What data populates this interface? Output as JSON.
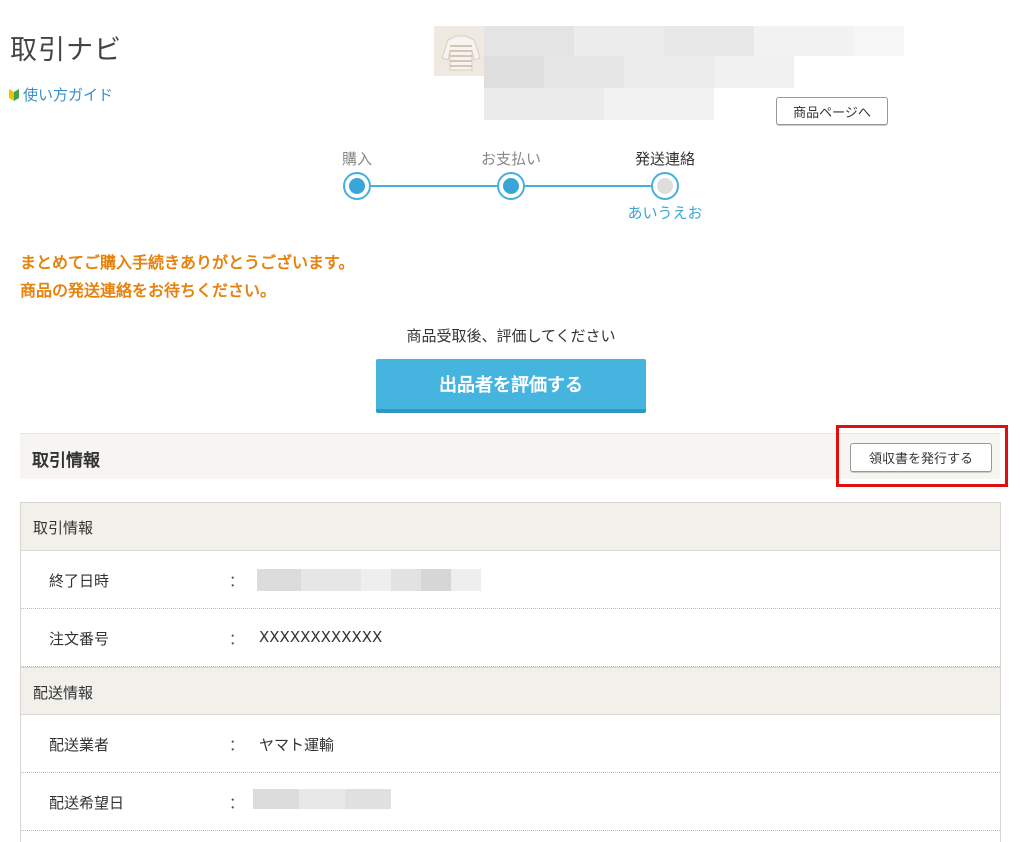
{
  "header": {
    "title": "取引ナビ",
    "guide_label": "使い方ガイド",
    "product_page_button": "商品ページへ"
  },
  "steps": [
    {
      "label": "購入",
      "state": "done"
    },
    {
      "label": "お支払い",
      "state": "done"
    },
    {
      "label": "発送連絡",
      "state": "current",
      "sub": "あいうえお"
    }
  ],
  "notice": {
    "line1": "まとめてご購入手続きありがとうございます。",
    "line2": "商品の発送連絡をお待ちください。"
  },
  "evaluation": {
    "prompt": "商品受取後、評価してください",
    "button": "出品者を評価する"
  },
  "transaction_section": {
    "title": "取引情報",
    "receipt_button": "領収書を発行する"
  },
  "table": {
    "groups": [
      {
        "header": "取引情報",
        "rows": [
          {
            "key": "終了日時",
            "sep": "：",
            "value": ""
          },
          {
            "key": "注文番号",
            "sep": "：",
            "value": "XXXXXXXXXXXX"
          }
        ]
      },
      {
        "header": "配送情報",
        "rows": [
          {
            "key": "配送業者",
            "sep": "：",
            "value": "ヤマト運輸"
          },
          {
            "key": "配送希望日",
            "sep": "：",
            "value": ""
          }
        ]
      }
    ]
  },
  "colors": {
    "accent_blue": "#45b5e0",
    "notice_orange": "#e6820e",
    "highlight_red": "#e01010"
  },
  "icons": {
    "guide": "beginner-leaf-icon"
  }
}
